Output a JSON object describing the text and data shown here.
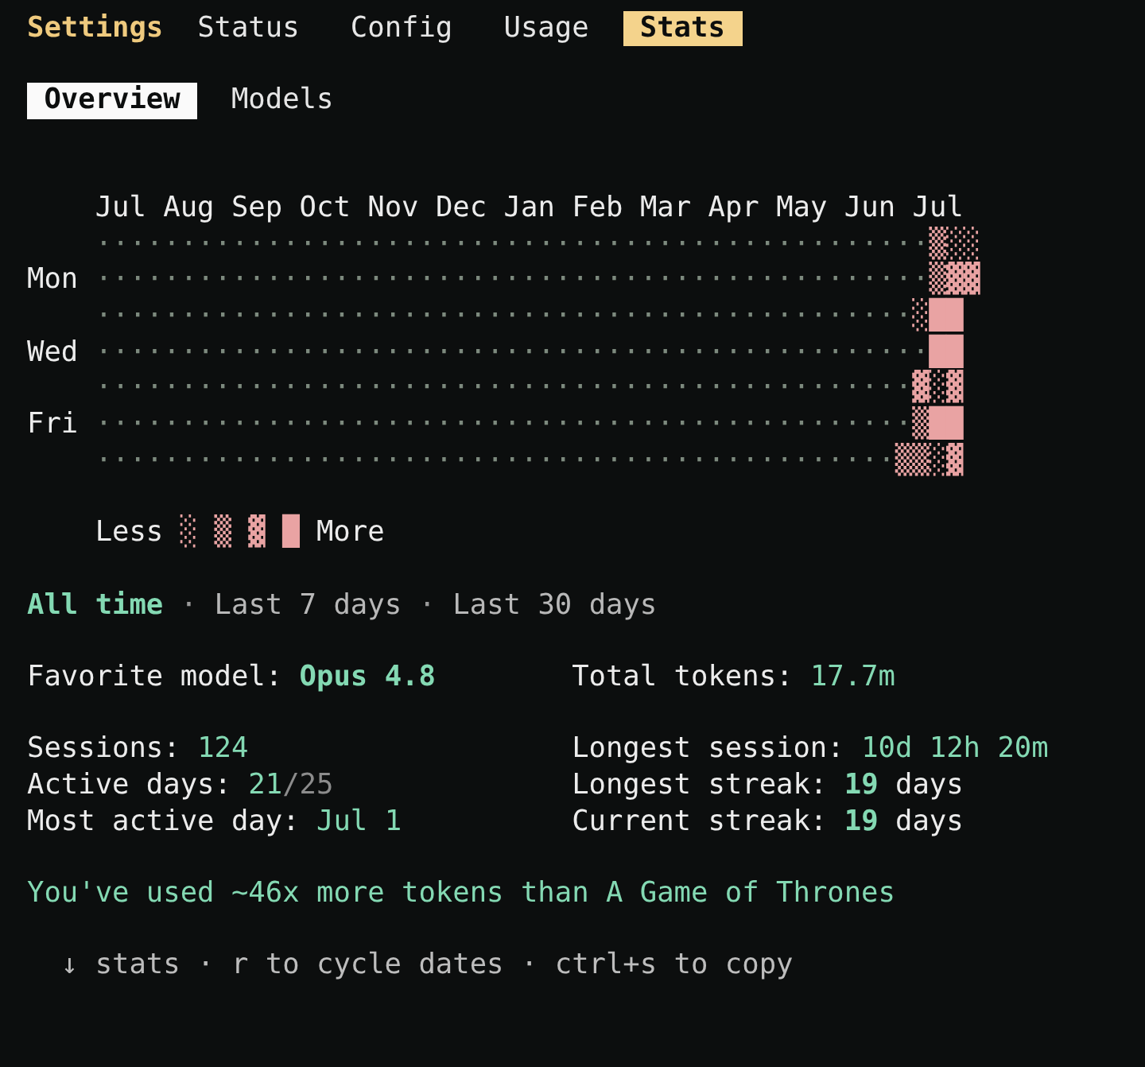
{
  "header": {
    "title": "Settings",
    "tabs": [
      {
        "label": "Status",
        "selected": false
      },
      {
        "label": "Config",
        "selected": false
      },
      {
        "label": "Usage",
        "selected": false
      },
      {
        "label": "Stats",
        "selected": true
      }
    ]
  },
  "subtabs": [
    {
      "label": "Overview",
      "selected": true
    },
    {
      "label": "Models",
      "selected": false
    }
  ],
  "heatmap": {
    "months": [
      "Jul",
      "Aug",
      "Sep",
      "Oct",
      "Nov",
      "Dec",
      "Jan",
      "Feb",
      "Mar",
      "Apr",
      "May",
      "Jun",
      "Jul"
    ],
    "rows": [
      {
        "empty": "·················································",
        "activity": "▒░░"
      },
      {
        "day": "Mon",
        "empty": "·················································",
        "activity": "▒▓▓"
      },
      {
        "empty": "················································",
        "activity": "░██"
      },
      {
        "day": "Wed",
        "empty": "·················································",
        "activity": "██"
      },
      {
        "empty": "················································",
        "activity": "▓░▓"
      },
      {
        "day": "Fri",
        "empty": "················································",
        "activity": "▒██"
      },
      {
        "empty": "···············································",
        "activity": "▒▒░▓"
      }
    ],
    "legend": {
      "less": "Less",
      "swatches": [
        "░",
        "▒",
        "▓",
        "█"
      ],
      "more": "More"
    }
  },
  "periods": [
    {
      "label": "All time",
      "selected": true
    },
    {
      "separator": "·",
      "label": "Last 7 days",
      "selected": false
    },
    {
      "separator": "·",
      "label": "Last 30 days",
      "selected": false
    }
  ],
  "highlights": [
    {
      "label": "Favorite model:",
      "value": "Opus 4.8",
      "emphasized": true
    },
    {
      "label": "Total tokens:",
      "value": "17.7m",
      "emphasized": false
    }
  ],
  "details": [
    {
      "kind": "plain",
      "label": "Sessions:",
      "value": "124",
      "emphasized": false
    },
    {
      "kind": "plain",
      "label": "Longest session:",
      "value": "10d 12h 20m",
      "emphasized": false
    },
    {
      "kind": "fraction",
      "label": "Active days:",
      "value": "21",
      "suffix": "/25",
      "emphasized": false
    },
    {
      "kind": "unit",
      "label": "Longest streak:",
      "value": "19",
      "suffix": "days",
      "emphasized": true
    },
    {
      "kind": "plain",
      "label": "Most active day:",
      "value": "Jul 1",
      "emphasized": false
    },
    {
      "kind": "unit",
      "label": "Current streak:",
      "value": "19",
      "suffix": "days",
      "emphasized": true
    }
  ],
  "fun_fact": "You've used ~46x more tokens than A Game of Thrones",
  "footer_hint": "↓ stats · r to cycle dates · ctrl+s to copy"
}
